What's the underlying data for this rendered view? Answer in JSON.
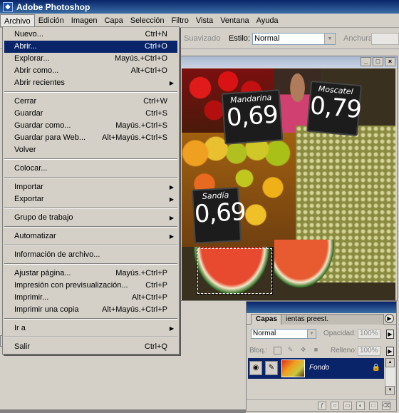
{
  "app": {
    "title": "Adobe Photoshop"
  },
  "menubar": {
    "items": [
      "Archivo",
      "Edición",
      "Imagen",
      "Capa",
      "Selección",
      "Filtro",
      "Vista",
      "Ventana",
      "Ayuda"
    ]
  },
  "options": {
    "suavizado": "Suavizado",
    "estilo_label": "Estilo:",
    "estilo_value": "Normal",
    "anchura": "Anchura"
  },
  "file_menu": {
    "items": [
      {
        "label": "Nuevo...",
        "shortcut": "Ctrl+N"
      },
      {
        "label": "Abrir...",
        "shortcut": "Ctrl+O",
        "highlighted": true
      },
      {
        "label": "Explorar...",
        "shortcut": "Mayús.+Ctrl+O"
      },
      {
        "label": "Abrir como...",
        "shortcut": "Alt+Ctrl+O"
      },
      {
        "label": "Abrir recientes",
        "submenu": true
      },
      {
        "label": "Cerrar",
        "shortcut": "Ctrl+W"
      },
      {
        "label": "Guardar",
        "shortcut": "Ctrl+S"
      },
      {
        "label": "Guardar como...",
        "shortcut": "Mayús.+Ctrl+S"
      },
      {
        "label": "Guardar para Web...",
        "shortcut": "Alt+Mayús.+Ctrl+S"
      },
      {
        "label": "Volver"
      },
      {
        "label": "Colocar..."
      },
      {
        "label": "Importar",
        "submenu": true
      },
      {
        "label": "Exportar",
        "submenu": true
      },
      {
        "label": "Grupo de trabajo",
        "submenu": true
      },
      {
        "label": "Automatizar",
        "submenu": true
      },
      {
        "label": "Información de archivo..."
      },
      {
        "label": "Ajustar página...",
        "shortcut": "Mayús.+Ctrl+P"
      },
      {
        "label": "Impresión con previsualización...",
        "shortcut": "Ctrl+P"
      },
      {
        "label": "Imprimir...",
        "shortcut": "Alt+Ctrl+P"
      },
      {
        "label": "Imprimir una copia",
        "shortcut": "Alt+Mayús.+Ctrl+P"
      },
      {
        "label": "Ir a",
        "submenu": true
      },
      {
        "label": "Salir",
        "shortcut": "Ctrl+Q"
      }
    ]
  },
  "photo": {
    "sign1_name": "Mandarina",
    "sign1_price": "0,69",
    "sign2_name": "Moscatel",
    "sign2_price": "0,79",
    "sign3_name": "Sandía",
    "sign3_price": "0,69"
  },
  "layers_panel": {
    "tab_active": "Capas",
    "tab_other": "ientas preest.",
    "blend_mode": "Normal",
    "opacity_label": "Opacidad:",
    "opacity_value": "100%",
    "lock_label": "Bloq.:",
    "fill_label": "Relleno:",
    "fill_value": "100%",
    "layer_name": "Fondo"
  },
  "colors": {
    "menu_highlight": "#0a246a",
    "title_gradient_start": "#0a246a",
    "title_gradient_end": "#3a6ea5"
  }
}
